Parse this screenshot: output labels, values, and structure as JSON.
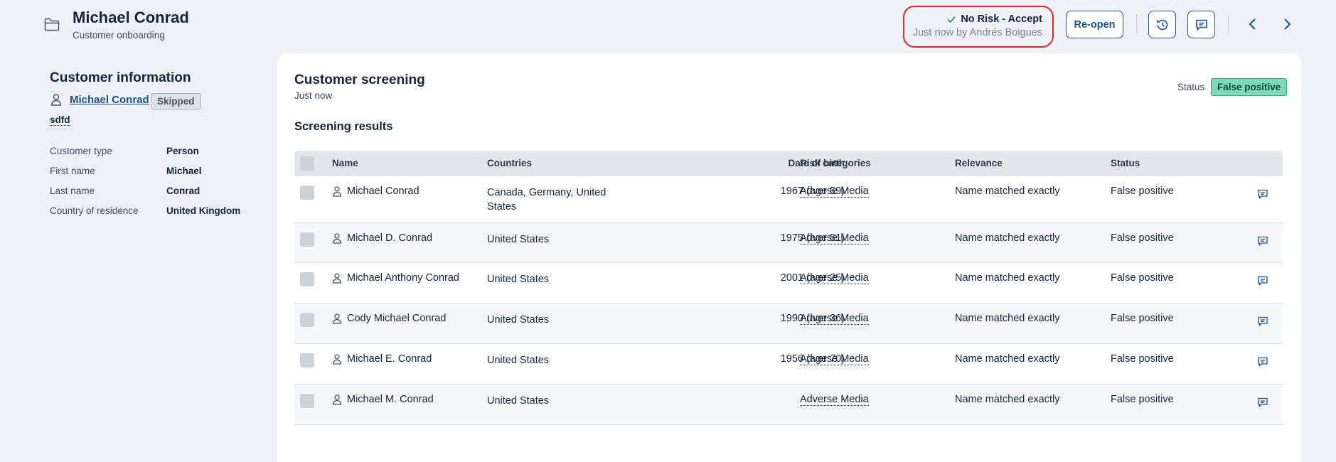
{
  "header": {
    "icon": "folder-icon",
    "title": "Michael Conrad",
    "subtitle": "Customer onboarding",
    "decision": {
      "label": "No Risk - Accept",
      "meta": "Just now by Andrés Boigues",
      "icon": "check-icon"
    },
    "reopen_label": "Re-open",
    "buttons": [
      "history-icon",
      "comment-icon",
      "chevron-left-icon",
      "chevron-right-icon"
    ],
    "highlight_color": "#e0262b",
    "accent_color": "#1d4f93"
  },
  "customer_info": {
    "title": "Customer information",
    "name": "Michael Conrad",
    "tag": "Skipped",
    "note": "sdfd",
    "fields": [
      {
        "label": "Customer type",
        "value": "Person"
      },
      {
        "label": "First name",
        "value": "Michael"
      },
      {
        "label": "Last name",
        "value": "Conrad"
      },
      {
        "label": "Country of residence",
        "value": "United Kingdom"
      }
    ]
  },
  "screening": {
    "title": "Customer screening",
    "time": "Just now",
    "status_label": "Status",
    "status_value": "False positive",
    "status_color": "#7fd9bb",
    "results_title": "Screening results",
    "columns": [
      "Name",
      "Countries",
      "Date of birth",
      "Risk categories",
      "Relevance",
      "Status"
    ],
    "rows": [
      {
        "name": "Michael Conrad",
        "countries": "Canada, Germany, United States",
        "dob": "1967 (age 59)",
        "risk": "Adverse Media",
        "relevance": "Name matched exactly",
        "status": "False positive"
      },
      {
        "name": "Michael D. Conrad",
        "countries": "United States",
        "dob": "1975 (age 51)",
        "risk": "Adverse Media",
        "relevance": "Name matched exactly",
        "status": "False positive"
      },
      {
        "name": "Michael Anthony Conrad",
        "countries": "United States",
        "dob": "2001 (age 25)",
        "risk": "Adverse Media",
        "relevance": "Name matched exactly",
        "status": "False positive"
      },
      {
        "name": "Cody Michael Conrad",
        "countries": "United States",
        "dob": "1990 (age 36)",
        "risk": "Adverse Media",
        "relevance": "Name matched exactly",
        "status": "False positive"
      },
      {
        "name": "Michael E. Conrad",
        "countries": "United States",
        "dob": "1956 (age 70)",
        "risk": "Adverse Media",
        "relevance": "Name matched exactly",
        "status": "False positive"
      },
      {
        "name": "Michael M. Conrad",
        "countries": "United States",
        "dob": "-",
        "risk": "Adverse Media",
        "relevance": "Name matched exactly",
        "status": "False positive"
      }
    ]
  }
}
